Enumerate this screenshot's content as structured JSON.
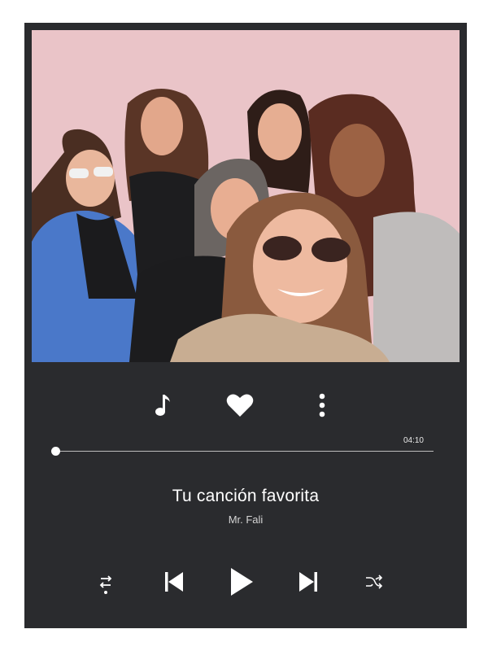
{
  "colors": {
    "card_background": "#2a2b2e",
    "artwork_background": "#eac4c8",
    "icon_color": "#ffffff",
    "track_color": "#bdbdbd"
  },
  "artwork": {
    "description_icon": "group-illustration"
  },
  "actions": {
    "icons": [
      "music-note-icon",
      "heart-icon",
      "more-vertical-icon"
    ]
  },
  "player": {
    "duration": "04:10",
    "progress_fraction": 0.01
  },
  "track": {
    "title": "Tu canción favorita",
    "artist": "Mr. Fali"
  },
  "controls": {
    "icons": [
      "repeat-icon",
      "previous-icon",
      "play-icon",
      "next-icon",
      "shuffle-icon"
    ]
  }
}
